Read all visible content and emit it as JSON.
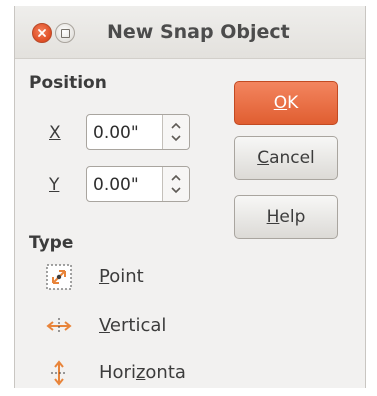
{
  "window": {
    "title": "New Snap Object"
  },
  "position": {
    "section_label": "Position",
    "x": {
      "label": "X",
      "value": "0.00\""
    },
    "y": {
      "label": "Y",
      "value": "0.00\""
    }
  },
  "buttons": {
    "ok": {
      "mnemonic": "O",
      "rest": "K"
    },
    "cancel": {
      "mnemonic": "C",
      "rest": "ancel"
    },
    "help": {
      "mnemonic": "H",
      "rest": "elp"
    }
  },
  "type": {
    "section_label": "Type",
    "options": {
      "point": {
        "pre": "",
        "mnemonic": "P",
        "post": "oint",
        "icon": "snap-point-icon",
        "selected": true
      },
      "vertical": {
        "pre": "",
        "mnemonic": "V",
        "post": "ertical",
        "icon": "snap-vertical-icon",
        "selected": false
      },
      "horizontal": {
        "pre": "Hori",
        "mnemonic": "z",
        "post": "onta",
        "icon": "snap-horizontal-icon",
        "selected": false
      }
    }
  },
  "colors": {
    "accent": "#e05e31",
    "dialog_bg": "#f2f1f0",
    "icon_orange": "#e8843a"
  }
}
